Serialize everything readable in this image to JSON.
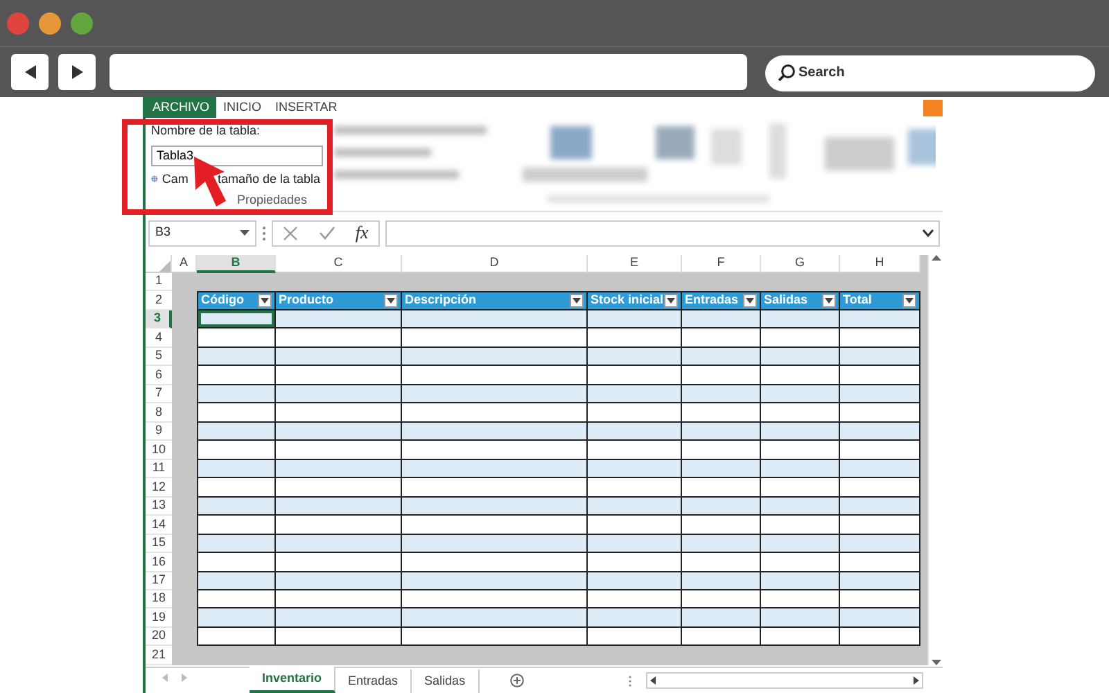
{
  "browser": {
    "search_placeholder": "Search"
  },
  "ribbon": {
    "tabs": [
      {
        "label": "ARCHIVO",
        "selected": true
      },
      {
        "label": "INICIO",
        "selected": false
      },
      {
        "label": "INSERTAR",
        "selected": false
      }
    ],
    "table_name_label": "Nombre de la tabla:",
    "table_name_value": "Tabla3",
    "resize_visible_start": "Cam",
    "resize_visible_end": "tamaño de la tabla",
    "group_label": "Propiedades"
  },
  "formula_bar": {
    "name_box": "B3",
    "fx": "fx"
  },
  "sheet": {
    "columns": [
      {
        "label": "A",
        "selected": false
      },
      {
        "label": "B",
        "selected": true
      },
      {
        "label": "C",
        "selected": false
      },
      {
        "label": "D",
        "selected": false
      },
      {
        "label": "E",
        "selected": false
      },
      {
        "label": "F",
        "selected": false
      },
      {
        "label": "G",
        "selected": false
      },
      {
        "label": "H",
        "selected": false
      }
    ],
    "table_headers": [
      "Código",
      "Producto",
      "Descripción",
      "Stock inicial",
      "Entradas",
      "Salidas",
      "Total"
    ],
    "rows": [
      {
        "label": "1",
        "kind": "blank",
        "selected": false
      },
      {
        "label": "2",
        "kind": "header",
        "selected": false
      },
      {
        "label": "3",
        "kind": "band",
        "selected": true
      },
      {
        "label": "4",
        "kind": "plain",
        "selected": false
      },
      {
        "label": "5",
        "kind": "band",
        "selected": false
      },
      {
        "label": "6",
        "kind": "plain",
        "selected": false
      },
      {
        "label": "7",
        "kind": "band",
        "selected": false
      },
      {
        "label": "8",
        "kind": "plain",
        "selected": false
      },
      {
        "label": "9",
        "kind": "band",
        "selected": false
      },
      {
        "label": "10",
        "kind": "plain",
        "selected": false
      },
      {
        "label": "11",
        "kind": "band",
        "selected": false
      },
      {
        "label": "12",
        "kind": "plain",
        "selected": false
      },
      {
        "label": "13",
        "kind": "band",
        "selected": false
      },
      {
        "label": "14",
        "kind": "plain",
        "selected": false
      },
      {
        "label": "15",
        "kind": "band",
        "selected": false
      },
      {
        "label": "16",
        "kind": "plain",
        "selected": false
      },
      {
        "label": "17",
        "kind": "band",
        "selected": false
      },
      {
        "label": "18",
        "kind": "plain",
        "selected": false
      },
      {
        "label": "19",
        "kind": "band",
        "selected": false
      },
      {
        "label": "20",
        "kind": "plain",
        "selected": false
      },
      {
        "label": "21",
        "kind": "blank",
        "selected": false
      }
    ]
  },
  "sheet_tabs": [
    {
      "label": "Inventario",
      "selected": true
    },
    {
      "label": "Entradas",
      "selected": false
    },
    {
      "label": "Salidas",
      "selected": false
    }
  ]
}
